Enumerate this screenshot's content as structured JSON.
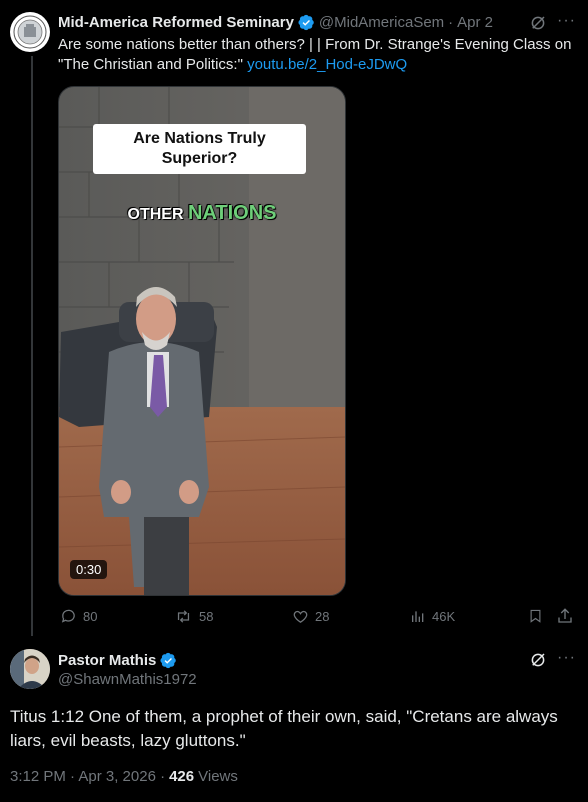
{
  "tweet1": {
    "author_name": "Mid-America Reformed Seminary",
    "handle": "@MidAmericaSem",
    "separator": "·",
    "date": "Apr 2",
    "text": "Are some nations better than others? |  | From Dr. Strange's Evening Class on \"The Christian and Politics:\"",
    "link_text": "youtu.be/2_Hod-eJDwQ",
    "media": {
      "title_card": "Are Nations Truly Superior?",
      "caption_word1": "OTHER",
      "caption_word2": "NATIONS",
      "duration": "0:30"
    },
    "actions": {
      "replies": "80",
      "reposts": "58",
      "likes": "28",
      "views": "46K"
    }
  },
  "tweet2": {
    "author_name": "Pastor Mathis",
    "handle": "@ShawnMathis1972",
    "text": "Titus 1:12 One of them, a prophet of their own, said, \"Cretans are always liars, evil beasts, lazy gluttons.\"",
    "time": "3:12 PM · Apr 3, 2026 ·",
    "views_count": "426",
    "views_label": "Views"
  },
  "colors": {
    "background": "#000000",
    "text": "#e7e9ea",
    "muted": "#71767b",
    "link": "#1d9bf0",
    "caption_green": "#6fcf7a"
  }
}
